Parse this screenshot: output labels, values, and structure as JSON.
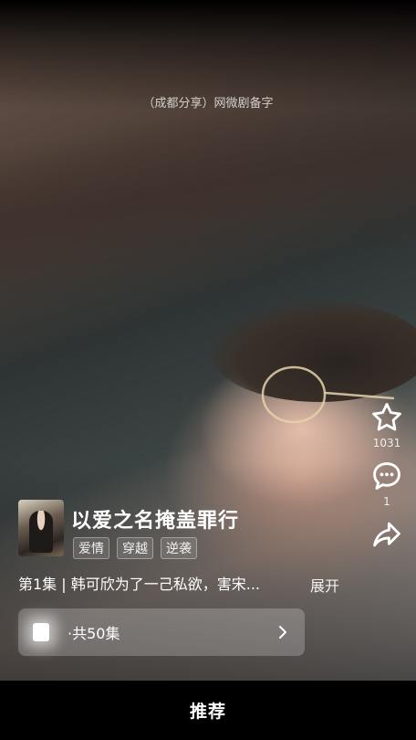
{
  "watermark": "（成都分享）网微剧备字",
  "actions": {
    "like_count": "1031",
    "comment_count": "1",
    "share_count": ""
  },
  "drama": {
    "title": "以爱之名掩盖罪行",
    "tags": [
      "爱情",
      "穿越",
      "逆袭"
    ],
    "description": "第1集 | 韩可欣为了一己私欲，害宋...",
    "expand_label": "展开",
    "episodes_label": "·共50集"
  },
  "tabbar": {
    "active_tab": "推荐"
  },
  "icons": {
    "like": "star-icon",
    "comment": "comment-icon",
    "share": "share-icon",
    "episodes": "episode-list-icon",
    "chevron": "chevron-right-icon"
  }
}
